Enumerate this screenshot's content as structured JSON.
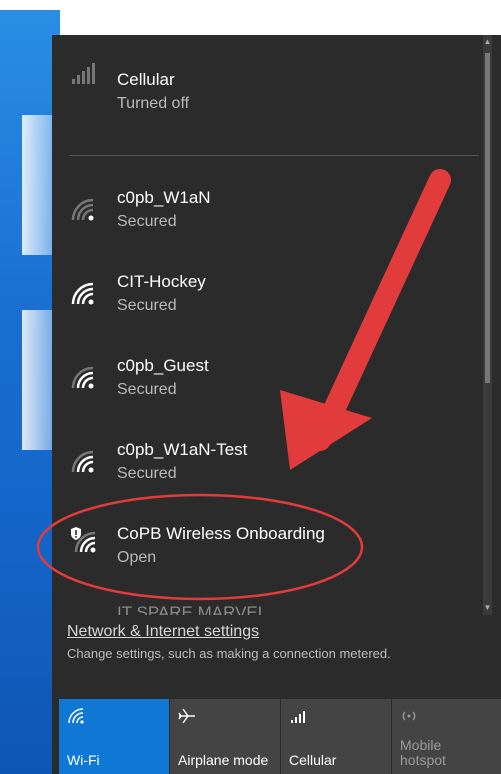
{
  "networks": [
    {
      "name": "Cellular",
      "status": "Turned off",
      "icon": "cellular-signal-icon"
    },
    {
      "name": "c0pb_W1aN",
      "status": "Secured",
      "icon": "wifi-icon"
    },
    {
      "name": "CIT-Hockey",
      "status": "Secured",
      "icon": "wifi-icon"
    },
    {
      "name": "c0pb_Guest",
      "status": "Secured",
      "icon": "wifi-icon"
    },
    {
      "name": "c0pb_W1aN-Test",
      "status": "Secured",
      "icon": "wifi-icon"
    },
    {
      "name": "CoPB Wireless Onboarding",
      "status": "Open",
      "icon": "wifi-shield-icon"
    },
    {
      "name": "IT SPARE MARVEL",
      "status": "",
      "icon": "wifi-icon"
    }
  ],
  "settings": {
    "link": "Network & Internet settings",
    "description": "Change settings, such as making a connection metered."
  },
  "quick_actions": [
    {
      "label": "Wi-Fi",
      "icon": "wifi-icon",
      "active": true
    },
    {
      "label": "Airplane mode",
      "icon": "airplane-icon",
      "active": false
    },
    {
      "label": "Cellular",
      "icon": "cellular-signal-icon",
      "active": false
    },
    {
      "label": "Mobile hotspot",
      "line1": "Mobile",
      "line2": "hotspot",
      "icon": "hotspot-icon",
      "active": false
    }
  ],
  "colors": {
    "panel_bg": "#2b2b2b",
    "accent": "#0f78d4",
    "annotation": "#e23b3b"
  }
}
